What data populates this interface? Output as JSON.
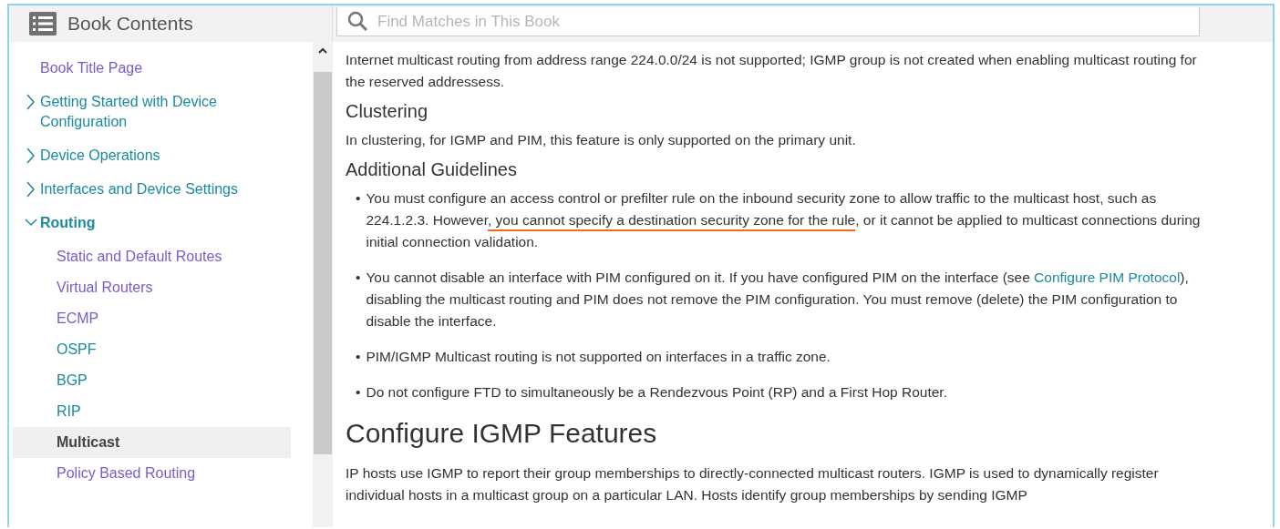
{
  "sidebar": {
    "title": "Book Contents",
    "items": [
      {
        "label": "Book Title Page",
        "visited": true,
        "selected": false
      },
      {
        "label": "Getting Started with Device Configuration",
        "visited": false,
        "selected": false,
        "expanded": false
      },
      {
        "label": "Device Operations",
        "visited": false,
        "selected": false,
        "expanded": false
      },
      {
        "label": "Interfaces and Device Settings",
        "visited": false,
        "selected": false,
        "expanded": false
      },
      {
        "label": "Routing",
        "visited": false,
        "selected": false,
        "expanded": true,
        "children": [
          {
            "label": "Static and Default Routes",
            "visited": true,
            "selected": false
          },
          {
            "label": "Virtual Routers",
            "visited": true,
            "selected": false
          },
          {
            "label": "ECMP",
            "visited": true,
            "selected": false
          },
          {
            "label": "OSPF",
            "visited": false,
            "selected": false
          },
          {
            "label": "BGP",
            "visited": false,
            "selected": false
          },
          {
            "label": "RIP",
            "visited": false,
            "selected": false
          },
          {
            "label": "Multicast",
            "visited": false,
            "selected": true
          },
          {
            "label": "Policy Based Routing",
            "visited": true,
            "selected": false
          }
        ]
      }
    ]
  },
  "search": {
    "placeholder": "Find Matches in This Book"
  },
  "content": [
    {
      "kind": "paragraph",
      "parts": [
        {
          "kind": "text",
          "text": "Internet multicast routing from address range 224.0.0/24 is not supported; IGMP group is not created when enabling multicast routing for the reserved addressess."
        }
      ]
    },
    {
      "kind": "subheading",
      "text": "Clustering"
    },
    {
      "kind": "paragraph",
      "parts": [
        {
          "kind": "text",
          "text": "In clustering, for IGMP and PIM, this feature is only supported on the primary unit."
        }
      ]
    },
    {
      "kind": "subheading",
      "text": "Additional Guidelines"
    },
    {
      "kind": "bullet",
      "marker": "•",
      "parts": [
        {
          "kind": "text",
          "text": "You must configure an access control or prefilter rule on the inbound security zone to allow traffic to the multicast host, such as 224.1.2.3. However"
        },
        {
          "kind": "marked",
          "text": ", you cannot specify a destination security zone for the rule"
        },
        {
          "kind": "text",
          "text": ", or it cannot be applied to multicast connections during initial connection validation."
        }
      ]
    },
    {
      "kind": "bullet",
      "marker": "•",
      "parts": [
        {
          "kind": "text",
          "text": "You cannot disable an interface with PIM configured on it. If you have configured PIM on the interface (see "
        },
        {
          "kind": "link",
          "text": "Configure PIM Protocol"
        },
        {
          "kind": "text",
          "text": "), disabling the multicast routing and PIM does not remove the PIM configuration. You must remove (delete) the PIM configuration to disable the interface."
        }
      ]
    },
    {
      "kind": "bullet",
      "marker": "•",
      "parts": [
        {
          "kind": "text",
          "text": "PIM/IGMP Multicast routing is not supported on interfaces in a traffic zone."
        }
      ]
    },
    {
      "kind": "bullet",
      "marker": "•",
      "parts": [
        {
          "kind": "text",
          "text": "Do not configure FTD to simultaneously be a Rendezvous Point (RP) and a First Hop Router."
        }
      ]
    },
    {
      "kind": "heading",
      "text": "Configure IGMP Features"
    },
    {
      "kind": "paragraph",
      "parts": [
        {
          "kind": "text",
          "text": "IP hosts use IGMP to report their group memberships to directly-connected multicast routers. IGMP is used to dynamically register individual hosts in a multicast group on a particular LAN. Hosts identify group memberships by sending IGMP"
        }
      ]
    }
  ]
}
